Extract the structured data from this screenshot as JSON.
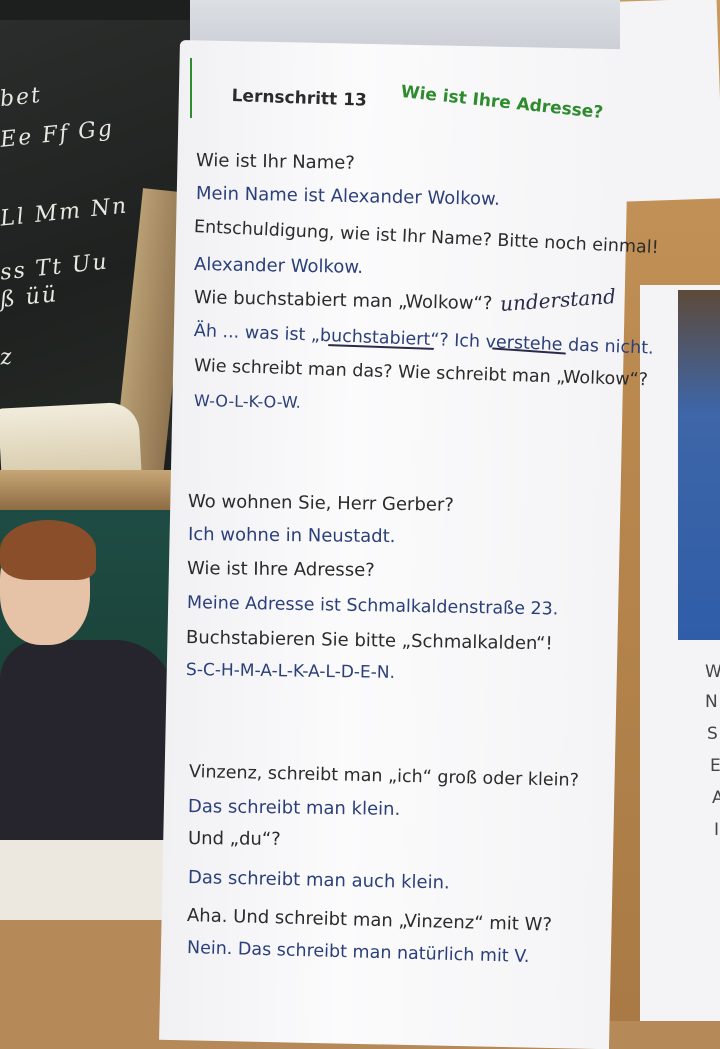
{
  "background_photo": {
    "chalkboard_rows": [
      "bet",
      "Ee Ff Gg",
      "Ll Mm Nn",
      "ss Tt Uu",
      "ß   üü",
      "z"
    ]
  },
  "lesson": {
    "step_label": "Lernschritt 13",
    "title": "Wie ist Ihre Adresse?",
    "dialogs": [
      {
        "lines": [
          {
            "text": "Wie ist Ihr Name?",
            "speaker": "q"
          },
          {
            "text": "Mein Name ist Alexander Wolkow.",
            "speaker": "a"
          },
          {
            "text": "Entschuldigung, wie ist Ihr Name? Bitte noch einmal!",
            "speaker": "q"
          },
          {
            "text": "Alexander Wolkow.",
            "speaker": "a"
          },
          {
            "text": "Wie buchstabiert man „Wolkow“?",
            "speaker": "q"
          },
          {
            "text": "Äh ... was ist „buchstabiert“? Ich verstehe das nicht.",
            "speaker": "a"
          },
          {
            "text": "Wie schreibt man das? Wie schreibt man „Wolkow“?",
            "speaker": "q"
          },
          {
            "text": "W-O-L-K-O-W.",
            "speaker": "a"
          }
        ]
      },
      {
        "lines": [
          {
            "text": "Wo wohnen Sie, Herr Gerber?",
            "speaker": "q"
          },
          {
            "text": "Ich wohne in Neustadt.",
            "speaker": "a"
          },
          {
            "text": "Wie ist Ihre Adresse?",
            "speaker": "q"
          },
          {
            "text": "Meine Adresse ist Schmalkaldenstraße 23.",
            "speaker": "a"
          },
          {
            "text": "Buchstabieren Sie bitte „Schmalkalden“!",
            "speaker": "q"
          },
          {
            "text": "S-C-H-M-A-L-K-A-L-D-E-N.",
            "speaker": "a"
          }
        ]
      },
      {
        "lines": [
          {
            "text": "Vinzenz, schreibt man „ich“ groß oder klein?",
            "speaker": "q"
          },
          {
            "text": "Das schreibt man klein.",
            "speaker": "a"
          },
          {
            "text": "Und „du“?",
            "speaker": "q"
          },
          {
            "text": "Das schreibt man auch klein.",
            "speaker": "a"
          },
          {
            "text": "Aha. Und schreibt man „Vinzenz“ mit W?",
            "speaker": "q"
          },
          {
            "text": "Nein. Das schreibt man natürlich mit V.",
            "speaker": "a"
          }
        ]
      }
    ],
    "handwritten_note": "understand"
  },
  "right_page_letters": [
    "W",
    "N",
    "S",
    "E",
    "A",
    "I"
  ]
}
